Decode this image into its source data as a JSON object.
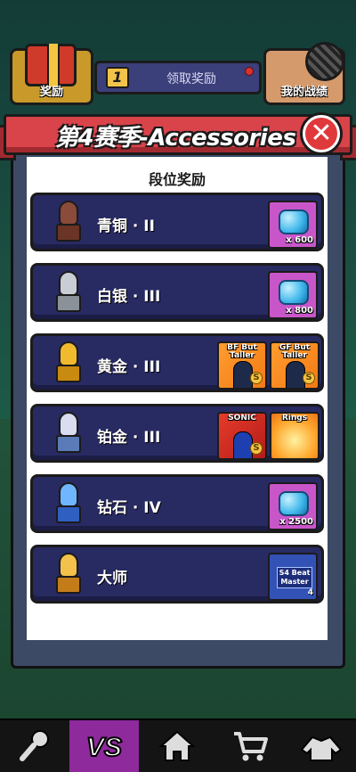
{
  "topbar": {
    "gift_label": "奖励",
    "claim_count": "1",
    "claim_label": "领取奖励",
    "record_label": "我的战绩"
  },
  "dialog": {
    "title": "第4赛季-Accessories",
    "close_glyph": "✕",
    "section_title": "段位奖励"
  },
  "tiers": [
    {
      "name": "青铜 · II",
      "badge_color": "#8a4b3a",
      "rewards": [
        {
          "type": "gem",
          "amount": "x 600"
        }
      ]
    },
    {
      "name": "白银 · III",
      "badge_color": "#9aa3ad",
      "rewards": [
        {
          "type": "gem",
          "amount": "x 800"
        }
      ]
    },
    {
      "name": "黄金 · III",
      "badge_color": "#f1b92e",
      "rewards": [
        {
          "type": "skin",
          "caption": "BF But Taller"
        },
        {
          "type": "skin",
          "caption": "GF But Taller"
        }
      ]
    },
    {
      "name": "铂金 · III",
      "badge_color": "#c9d2ea",
      "rewards": [
        {
          "type": "skin",
          "caption": "SONIC"
        },
        {
          "type": "skin",
          "caption": "Rings"
        }
      ]
    },
    {
      "name": "钻石 · IV",
      "badge_color": "#4c8ee8",
      "rewards": [
        {
          "type": "gem",
          "amount": "x 2500"
        }
      ]
    },
    {
      "name": "大师",
      "badge_color": "#e2a42a",
      "rewards": [
        {
          "type": "song",
          "caption": "S4 Beat Master",
          "count": "4"
        }
      ]
    }
  ],
  "nav": {
    "items": [
      "microphone-icon",
      "versus-icon",
      "home-icon",
      "cart-icon",
      "wardrobe-icon"
    ],
    "active": "versus-icon",
    "active_color": "#8e2a9c"
  },
  "colors": {
    "ribbon": "#d9434a",
    "row_bg": "#282a62",
    "gem_bg": "#c856c9"
  }
}
